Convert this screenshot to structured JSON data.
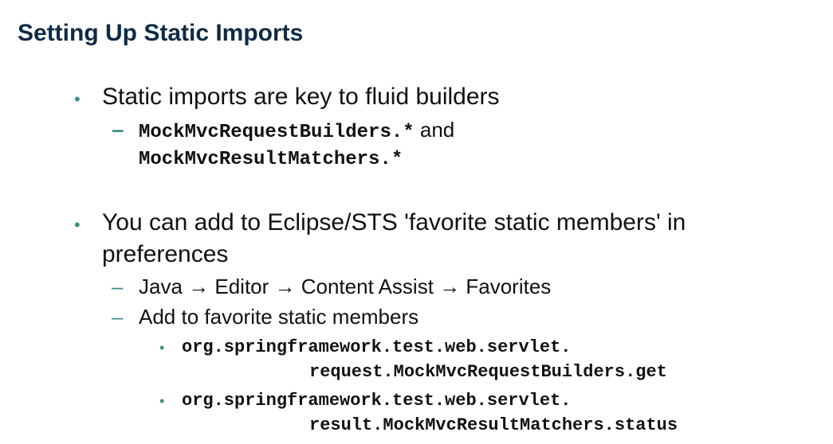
{
  "slide": {
    "title": "Setting Up Static Imports",
    "bullet1": {
      "text": "Static imports are key to fluid builders",
      "sub": {
        "code1": "MockMvcRequestBuilders.*",
        "and": " and",
        "code2": "MockMvcResultMatchers.*"
      }
    },
    "bullet2": {
      "line1": "You can add to Eclipse/STS 'favorite static members' in",
      "line2": "preferences",
      "sub1": "Java → Editor → Content Assist → Favorites",
      "sub2": "Add to favorite static members",
      "items": [
        {
          "line1": "org.springframework.test.web.servlet.",
          "line2": "request.MockMvcRequestBuilders.get"
        },
        {
          "line1": "org.springframework.test.web.servlet.",
          "line2": "result.MockMvcResultMatchers.status"
        }
      ]
    }
  },
  "glyphs": {
    "bullet": "•",
    "dash": "–"
  },
  "colors": {
    "title": "#0f2a44",
    "accent": "#3f8f8a",
    "text": "#111111"
  }
}
